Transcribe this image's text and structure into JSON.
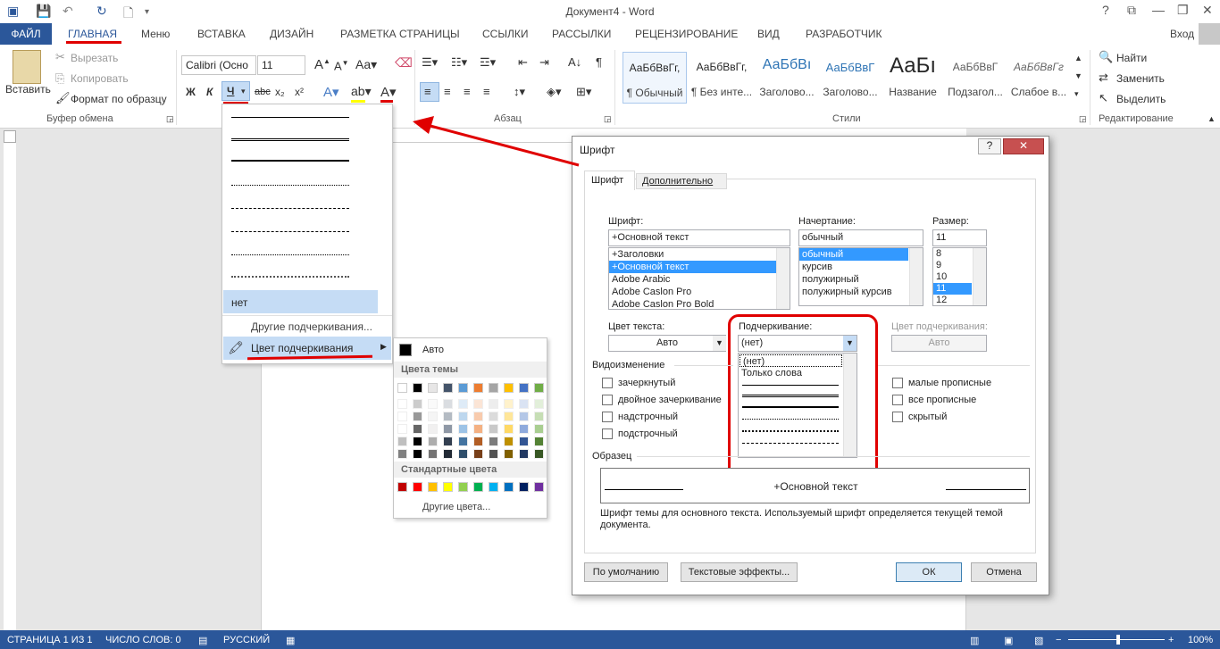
{
  "window": {
    "title": "Документ4 - Word",
    "login": "Вход"
  },
  "tabs": {
    "file": "ФАЙЛ",
    "items": [
      "ГЛАВНАЯ",
      "Меню",
      "ВСТАВКА",
      "ДИЗАЙН",
      "РАЗМЕТКА СТРАНИЦЫ",
      "ССЫЛКИ",
      "РАССЫЛКИ",
      "РЕЦЕНЗИРОВАНИЕ",
      "ВИД",
      "РАЗРАБОТЧИК"
    ]
  },
  "ribbon": {
    "clipboard": {
      "paste": "Вставить",
      "cut": "Вырезать",
      "copy": "Копировать",
      "format": "Формат по образцу",
      "label": "Буфер обмена"
    },
    "font": {
      "name": "Calibri (Осно",
      "size": "11",
      "bold": "Ж",
      "italic": "К",
      "underline": "Ч",
      "strike": "abc",
      "sub": "x₂",
      "sup": "x²"
    },
    "paragraph": {
      "label": "Абзац"
    },
    "styles": {
      "label": "Стили",
      "items": [
        {
          "sample": "АаБбВвГг,",
          "name": "¶ Обычный"
        },
        {
          "sample": "АаБбВвГг,",
          "name": "¶ Без инте..."
        },
        {
          "sample": "АаБбВı",
          "name": "Заголово..."
        },
        {
          "sample": "АаБбВвГ",
          "name": "Заголово..."
        },
        {
          "sample": "АаБı",
          "name": "Название"
        },
        {
          "sample": "АаБбВвГ",
          "name": "Подзагол..."
        },
        {
          "sample": "АаБбВвГг",
          "name": "Слабое в..."
        }
      ]
    },
    "editing": {
      "find": "Найти",
      "replace": "Заменить",
      "select": "Выделить",
      "label": "Редактирование"
    }
  },
  "underline_menu": {
    "none": "нет",
    "other": "Другие подчеркивания...",
    "color": "Цвет подчеркивания"
  },
  "color_menu": {
    "auto": "Авто",
    "theme": "Цвета темы",
    "standard": "Стандартные цвета",
    "more": "Другие цвета...",
    "theme_colors": [
      "#ffffff",
      "#000000",
      "#e7e6e6",
      "#44546a",
      "#5b9bd5",
      "#ed7d31",
      "#a5a5a5",
      "#ffc000",
      "#4472c4",
      "#70ad47"
    ],
    "standard_colors": [
      "#c00000",
      "#ff0000",
      "#ffc000",
      "#ffff00",
      "#92d050",
      "#00b050",
      "#00b0f0",
      "#0070c0",
      "#002060",
      "#7030a0"
    ]
  },
  "dialog": {
    "title": "Шрифт",
    "tab_font": "Шрифт",
    "tab_advanced": "Дополнительно",
    "font_label": "Шрифт:",
    "font_value": "+Основной текст",
    "font_list": [
      "+Заголовки",
      "+Основной текст",
      "Adobe Arabic",
      "Adobe Caslon Pro",
      "Adobe Caslon Pro Bold"
    ],
    "style_label": "Начертание:",
    "style_value": "обычный",
    "style_list": [
      "обычный",
      "курсив",
      "полужирный",
      "полужирный курсив"
    ],
    "size_label": "Размер:",
    "size_value": "11",
    "size_list": [
      "8",
      "9",
      "10",
      "11",
      "12"
    ],
    "color_label": "Цвет текста:",
    "color_value": "Авто",
    "underline_label": "Подчеркивание:",
    "underline_value": "(нет)",
    "underline_options": [
      "(нет)",
      "Только слова"
    ],
    "ucolor_label": "Цвет подчеркивания:",
    "ucolor_value": "Авто",
    "effects_label": "Видоизменение",
    "effects_left": [
      "зачеркнутый",
      "двойное зачеркивание",
      "надстрочный",
      "подстрочный"
    ],
    "effects_right": [
      "малые прописные",
      "все прописные",
      "скрытый"
    ],
    "preview_label": "Образец",
    "preview_text": "+Основной текст",
    "note": "Шрифт темы для основного текста. Используемый шрифт определяется текущей темой документа.",
    "btn_default": "По умолчанию",
    "btn_effects": "Текстовые эффекты...",
    "btn_ok": "ОК",
    "btn_cancel": "Отмена"
  },
  "status": {
    "page": "СТРАНИЦА 1 ИЗ 1",
    "words": "ЧИСЛО СЛОВ: 0",
    "lang": "РУССКИЙ",
    "zoom": "100%"
  }
}
